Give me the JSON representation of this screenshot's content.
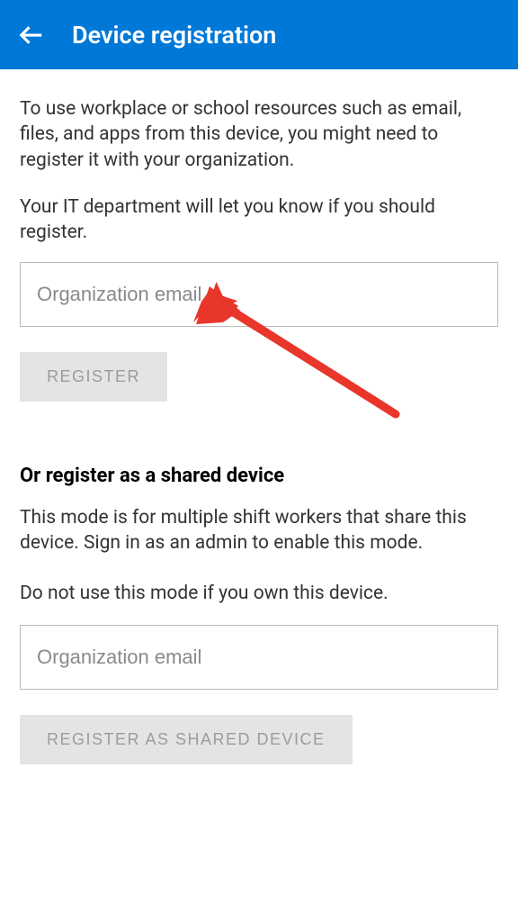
{
  "header": {
    "title": "Device registration"
  },
  "intro": {
    "text": "To use workplace or school resources such as email, files, and apps from this device, you might need to register it with your organization.",
    "subtext": "Your IT department will let you know if you should register."
  },
  "personal": {
    "email_placeholder": "Organization email",
    "register_button": "REGISTER"
  },
  "shared": {
    "heading": "Or register as a shared device",
    "description": "This mode is for multiple shift workers that share this device. Sign in as an admin to enable this mode.",
    "warning": "Do not use this mode if you own this device.",
    "email_placeholder": "Organization email",
    "register_button": "REGISTER AS SHARED DEVICE"
  }
}
